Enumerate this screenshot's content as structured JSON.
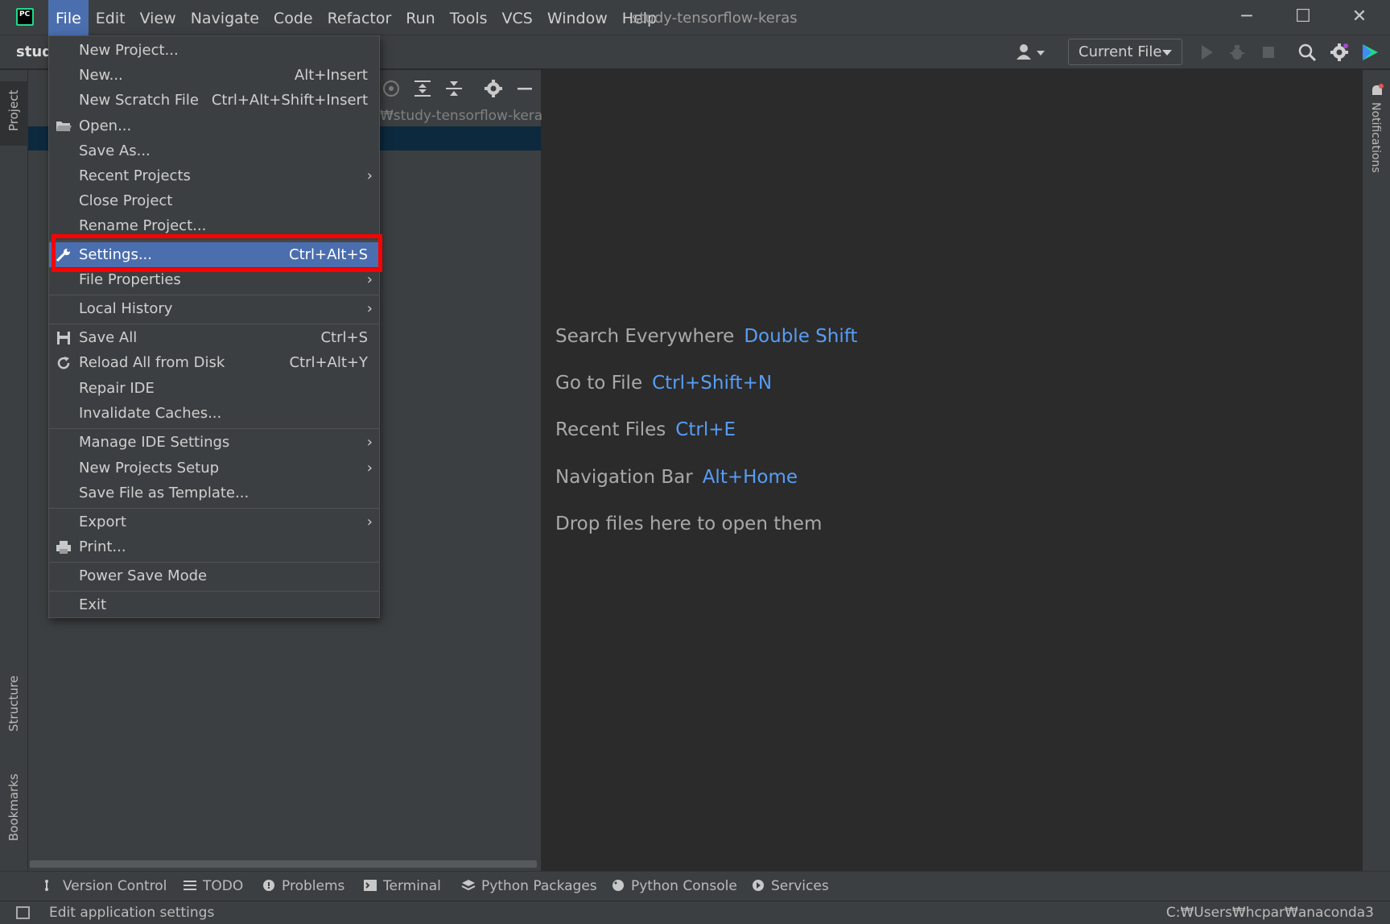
{
  "window": {
    "title": "study-tensorflow-keras",
    "logo_text": "PC",
    "controls": {
      "minimize": "─",
      "maximize": "☐",
      "close": "✕"
    }
  },
  "menubar": {
    "items": [
      "File",
      "Edit",
      "View",
      "Navigate",
      "Code",
      "Refactor",
      "Run",
      "Tools",
      "VCS",
      "Window",
      "Help"
    ],
    "active": "File"
  },
  "navbar": {
    "project_crumb": "study",
    "run_config": "Current File"
  },
  "project_panel": {
    "path_suffix": "₩study-tensorflow-keras"
  },
  "left_tabs": {
    "project": "Project",
    "structure": "Structure",
    "bookmarks": "Bookmarks"
  },
  "right_tabs": {
    "notifications": "Notifications"
  },
  "file_menu": {
    "items": [
      {
        "label": "New Project...",
        "shortcut": ""
      },
      {
        "label": "New...",
        "shortcut": "Alt+Insert"
      },
      {
        "label": "New Scratch File",
        "shortcut": "Ctrl+Alt+Shift+Insert"
      },
      {
        "label": "Open...",
        "shortcut": ""
      },
      {
        "label": "Save As...",
        "shortcut": ""
      },
      {
        "label": "Recent Projects",
        "shortcut": ""
      },
      {
        "label": "Close Project",
        "shortcut": ""
      },
      {
        "label": "Rename Project...",
        "shortcut": ""
      },
      {
        "label": "Settings...",
        "shortcut": "Ctrl+Alt+S"
      },
      {
        "label": "File Properties",
        "shortcut": ""
      },
      {
        "label": "Local History",
        "shortcut": ""
      },
      {
        "label": "Save All",
        "shortcut": "Ctrl+S"
      },
      {
        "label": "Reload All from Disk",
        "shortcut": "Ctrl+Alt+Y"
      },
      {
        "label": "Repair IDE",
        "shortcut": ""
      },
      {
        "label": "Invalidate Caches...",
        "shortcut": ""
      },
      {
        "label": "Manage IDE Settings",
        "shortcut": ""
      },
      {
        "label": "New Projects Setup",
        "shortcut": ""
      },
      {
        "label": "Save File as Template...",
        "shortcut": ""
      },
      {
        "label": "Export",
        "shortcut": ""
      },
      {
        "label": "Print...",
        "shortcut": ""
      },
      {
        "label": "Power Save Mode",
        "shortcut": ""
      },
      {
        "label": "Exit",
        "shortcut": ""
      }
    ],
    "submenu_arrow": "›"
  },
  "editor_hints": [
    {
      "text": "Search Everywhere",
      "key": "Double Shift"
    },
    {
      "text": "Go to File",
      "key": "Ctrl+Shift+N"
    },
    {
      "text": "Recent Files",
      "key": "Ctrl+E"
    },
    {
      "text": "Navigation Bar",
      "key": "Alt+Home"
    },
    {
      "text": "Drop files here to open them",
      "key": ""
    }
  ],
  "bottom_tools": [
    "Version Control",
    "TODO",
    "Problems",
    "Terminal",
    "Python Packages",
    "Python Console",
    "Services"
  ],
  "status": {
    "message": "Edit application settings",
    "interpreter_path": "C:₩Users₩hcpar₩anaconda3"
  },
  "colors": {
    "accent": "#4b6eaf",
    "highlight_box": "#ff0000",
    "hint_key": "#589df6",
    "background": "#2b2b2b",
    "panel": "#3c3f41"
  }
}
